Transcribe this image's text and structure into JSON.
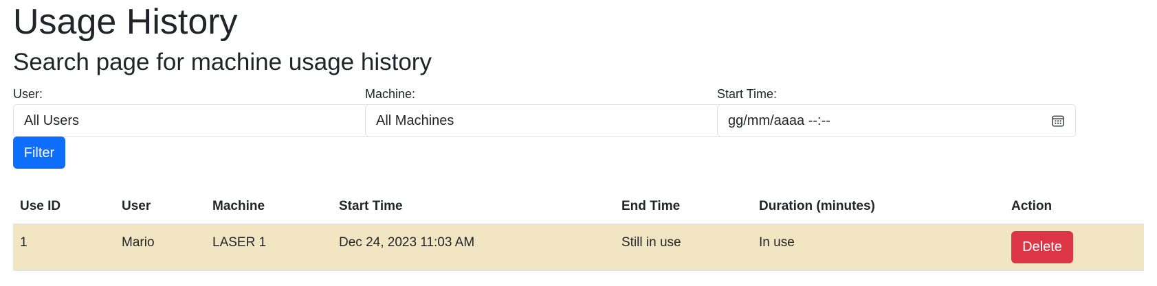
{
  "header": {
    "title": "Usage History",
    "subtitle": "Search page for machine usage history"
  },
  "filters": {
    "user": {
      "label": "User:",
      "value": "All Users"
    },
    "machine": {
      "label": "Machine:",
      "value": "All Machines"
    },
    "start_time": {
      "label": "Start Time:",
      "placeholder": "gg/mm/aaaa --:--",
      "icon": "calendar-icon"
    },
    "filter_button": "Filter"
  },
  "table": {
    "headers": [
      "Use ID",
      "User",
      "Machine",
      "Start Time",
      "End Time",
      "Duration (minutes)",
      "Action"
    ],
    "rows": [
      {
        "use_id": "1",
        "user": "Mario",
        "machine": "LASER 1",
        "start_time": "Dec 24, 2023 11:03 AM",
        "end_time": "Still in use",
        "duration": "In use",
        "action": "Delete"
      }
    ]
  },
  "colors": {
    "primary": "#0d6efd",
    "danger": "#dc3545",
    "row_highlight": "#f1e5c2"
  }
}
